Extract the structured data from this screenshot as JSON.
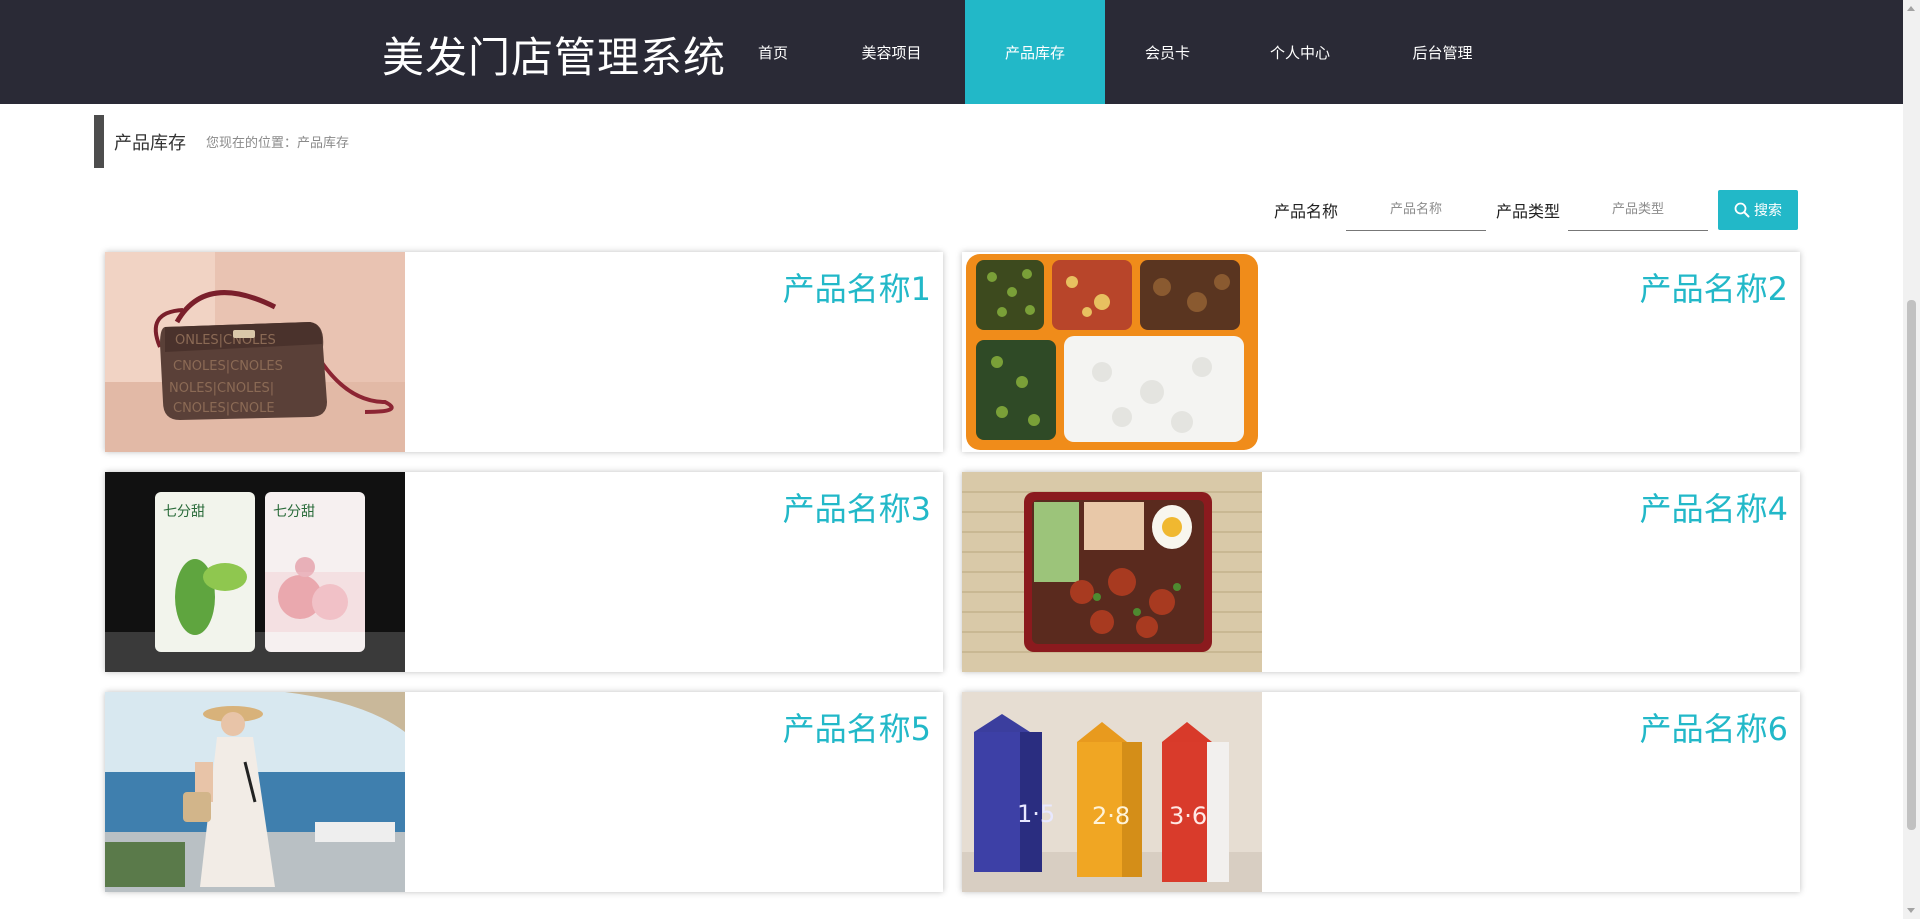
{
  "brand": "美发门店管理系统",
  "nav": [
    "首页",
    "美容项目",
    "产品库存",
    "会员卡",
    "个人中心",
    "后台管理"
  ],
  "active_nav": "产品库存",
  "breadcrumb": {
    "title": "产品库存",
    "location": "您现在的位置：产品库存"
  },
  "search": {
    "name_label": "产品名称",
    "name_placeholder": "产品名称",
    "type_label": "产品类型",
    "type_placeholder": "产品类型",
    "button": "搜索"
  },
  "products": [
    {
      "name": "产品名称1",
      "image": "handbag"
    },
    {
      "name": "产品名称2",
      "image": "bento-box-orange"
    },
    {
      "name": "产品名称3",
      "image": "face-mask-packs"
    },
    {
      "name": "产品名称4",
      "image": "bento-box-red"
    },
    {
      "name": "产品名称5",
      "image": "woman-seaside"
    },
    {
      "name": "产品名称6",
      "image": "milk-cartons"
    }
  ],
  "colors": {
    "accent": "#22b8c8",
    "topbar": "#2a2a36"
  }
}
